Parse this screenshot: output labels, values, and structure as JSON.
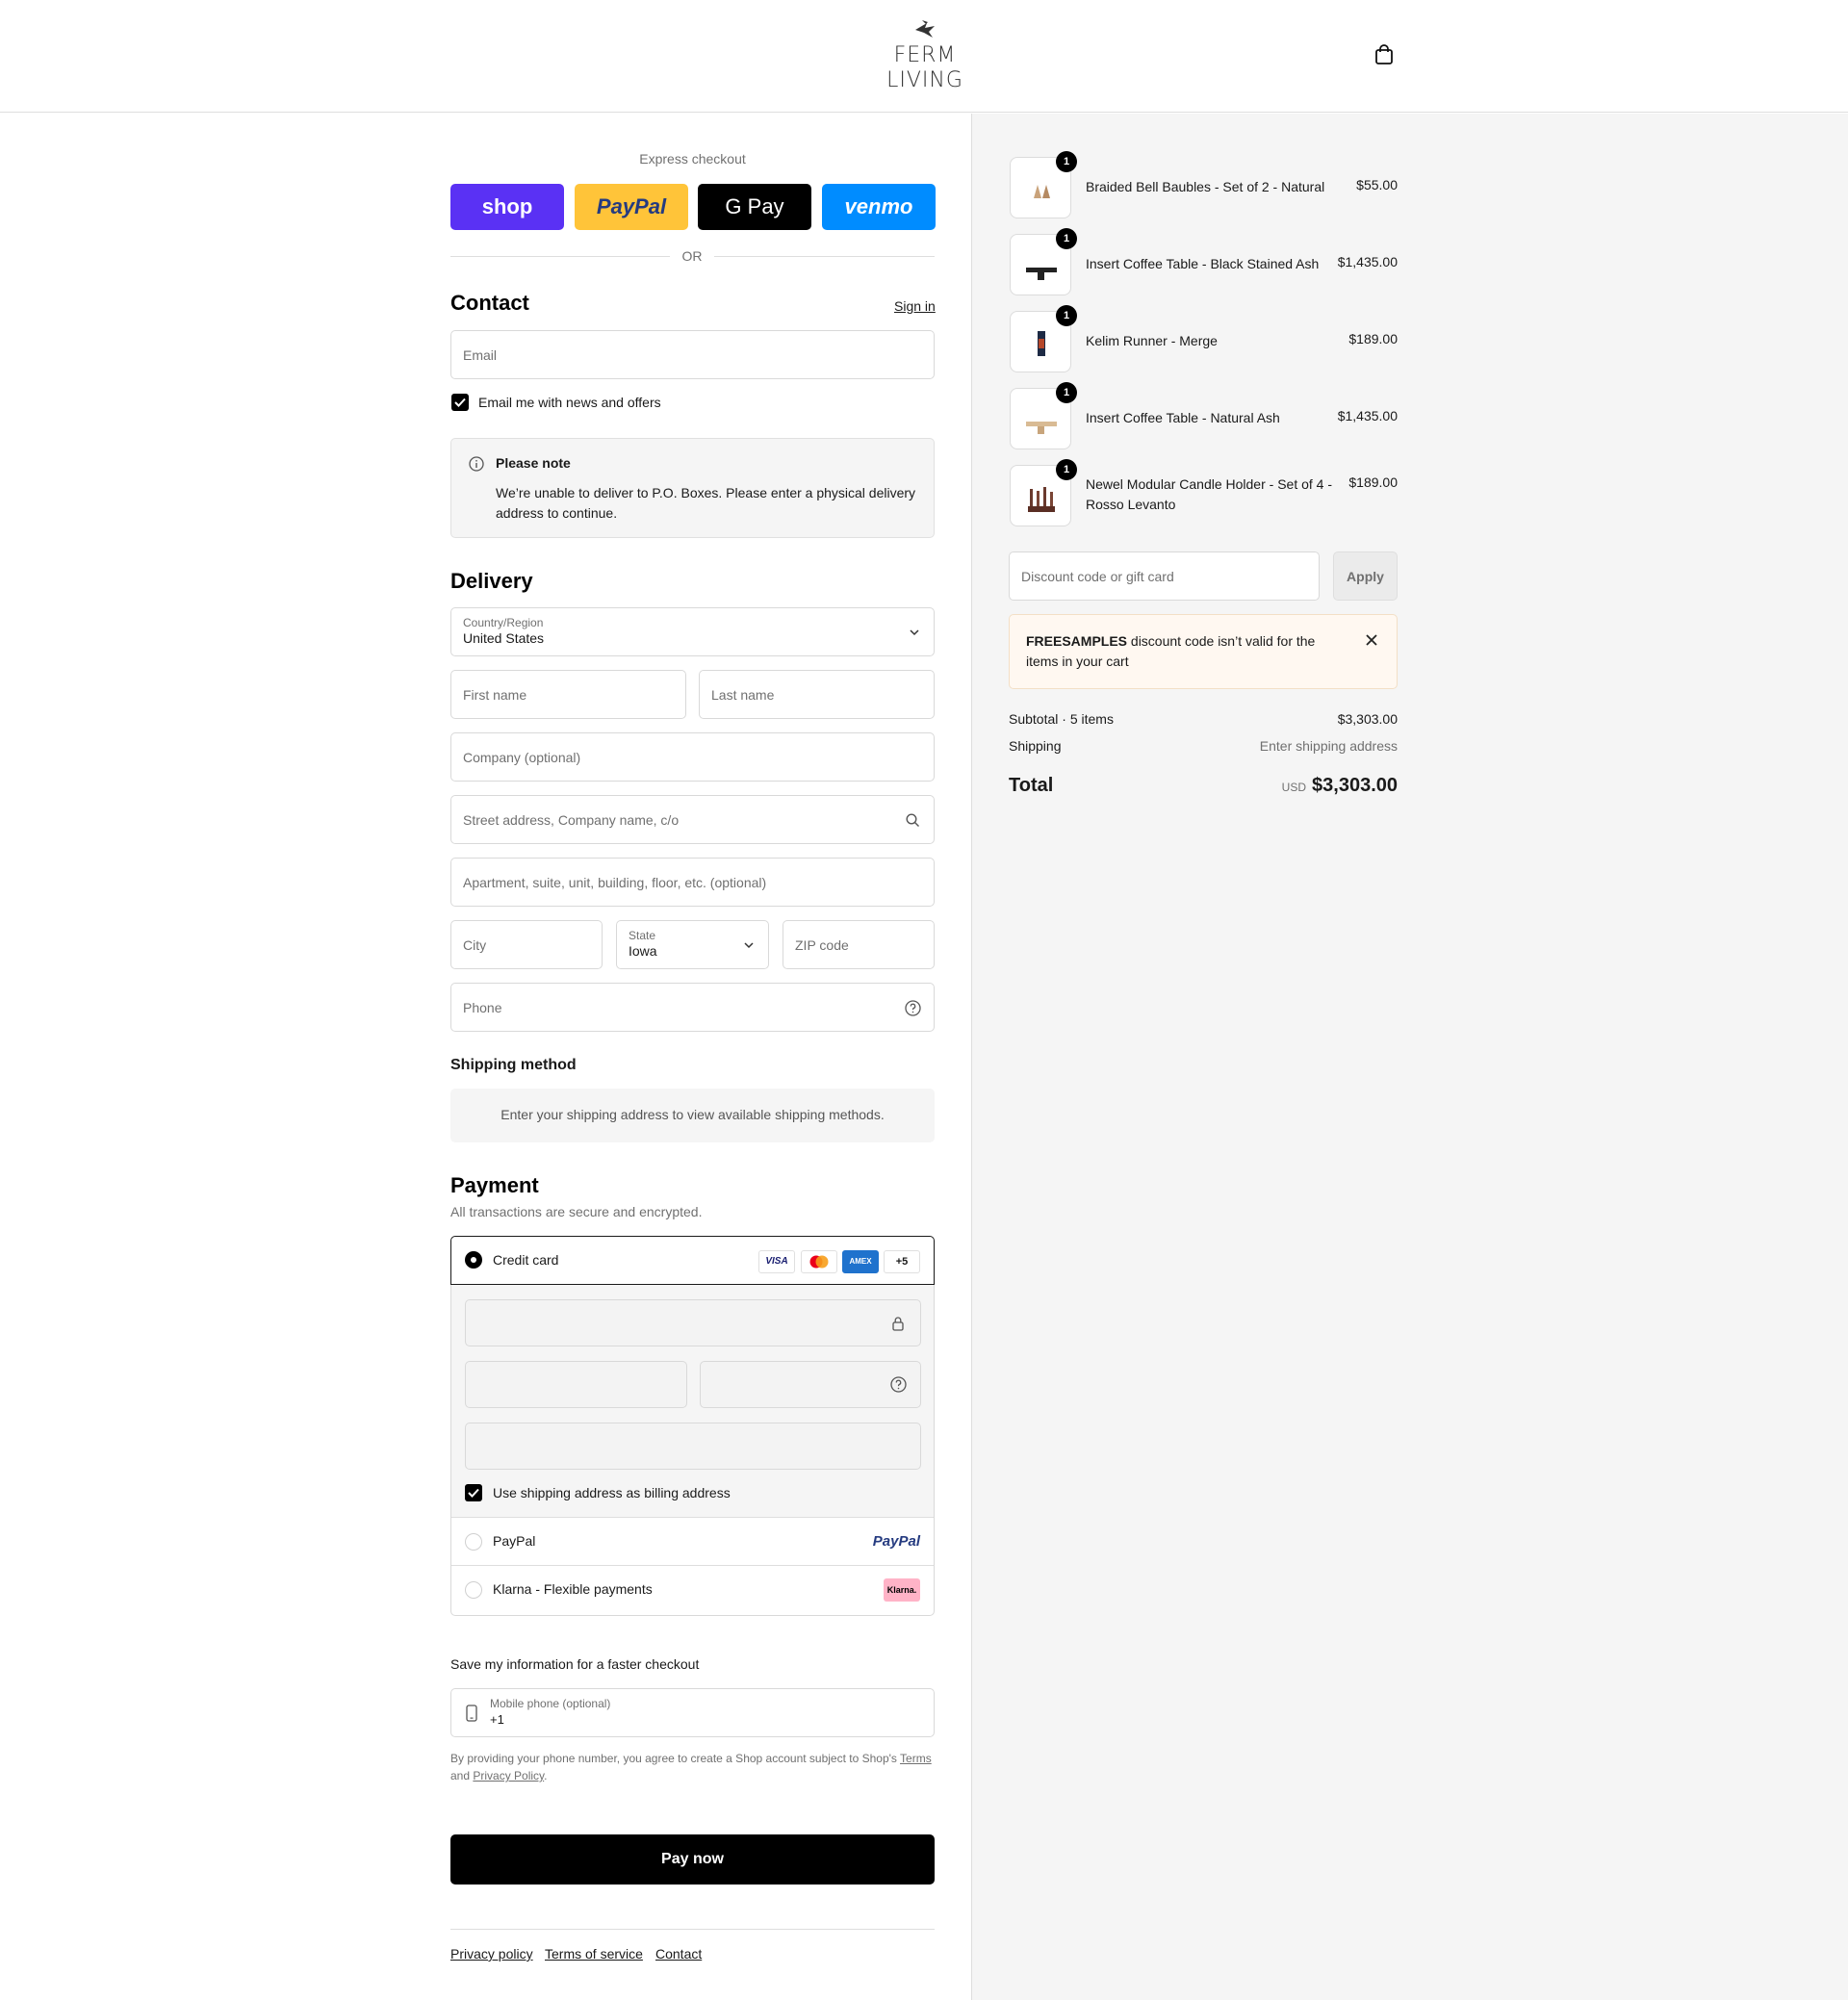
{
  "brand": {
    "logo_line1": "FERM",
    "logo_line2": "LIVING"
  },
  "express": {
    "title": "Express checkout",
    "buttons": [
      {
        "label": "shop",
        "bg": "#5a31f4"
      },
      {
        "label": "PayPal",
        "bg": "#ffc439"
      },
      {
        "label": "G Pay",
        "bg": "#000000"
      },
      {
        "label": "venmo",
        "bg": "#008cff"
      }
    ],
    "or_label": "OR"
  },
  "contact": {
    "title": "Contact",
    "sign_in": "Sign in",
    "email_placeholder": "Email",
    "newsletter_label": "Email me with news and offers",
    "newsletter_checked": true
  },
  "notice": {
    "title": "Please note",
    "body_line1": "We’re unable to deliver to P.O. Boxes. Please enter a physical delivery",
    "body_line2": "address to continue."
  },
  "delivery": {
    "title": "Delivery",
    "country_label": "Country/Region",
    "country_value": "United States",
    "first_name": "First name",
    "last_name": "Last name",
    "company": "Company (optional)",
    "street": "Street address, Company name, c/o",
    "apartment": "Apartment, suite, unit, building, floor, etc. (optional)",
    "city": "City",
    "state_label": "State",
    "state_value": "Iowa",
    "zip": "ZIP code",
    "phone": "Phone"
  },
  "shipping_method": {
    "title": "Shipping method",
    "message": "Enter your shipping address to view available shipping methods."
  },
  "payment": {
    "title": "Payment",
    "subtitle": "All transactions are secure and encrypted.",
    "credit_card_label": "Credit card",
    "card_brands": [
      "VISA",
      "MC",
      "AMEX",
      "+5"
    ],
    "billing_same_label": "Use shipping address as billing address",
    "paypal_label": "PayPal",
    "paypal_logo": "PayPal",
    "klarna_label": "Klarna - Flexible payments",
    "klarna_logo": "Klarna."
  },
  "save_info": {
    "title": "Save my information for a faster checkout",
    "mobile_label": "Mobile phone (optional)",
    "mobile_value": "+1",
    "legal_text_1": "By providing your phone number, you agree to create a Shop account subject to Shop's",
    "terms_link": "Terms",
    "legal_and": "and",
    "privacy_link": "Privacy Policy",
    "legal_end": "."
  },
  "pay_now": "Pay now",
  "footer_links": [
    "Privacy policy",
    "Terms of service",
    "Contact"
  ],
  "cart": {
    "items": [
      {
        "name": "Braided Bell Baubles - Set of 2 - Natural",
        "price": "$55.00",
        "qty": "1"
      },
      {
        "name": "Insert Coffee Table - Black Stained Ash",
        "price": "$1,435.00",
        "qty": "1"
      },
      {
        "name": "Kelim Runner - Merge",
        "price": "$189.00",
        "qty": "1"
      },
      {
        "name": "Insert Coffee Table - Natural Ash",
        "price": "$1,435.00",
        "qty": "1"
      },
      {
        "name": "Newel Modular Candle Holder - Set of 4 -",
        "name2": "Rosso Levanto",
        "price": "$189.00",
        "qty": "1"
      }
    ],
    "discount_placeholder": "Discount code or gift card",
    "apply_label": "Apply",
    "discount_error_code": "FREESAMPLES",
    "discount_error_msg1": " discount code isn’t valid for the",
    "discount_error_msg2": "items in your cart",
    "subtotal_label": "Subtotal · 5 items",
    "subtotal_value": "$3,303.00",
    "shipping_label": "Shipping",
    "shipping_value": "Enter shipping address",
    "total_label": "Total",
    "currency": "USD",
    "total_value": "$3,303.00"
  }
}
